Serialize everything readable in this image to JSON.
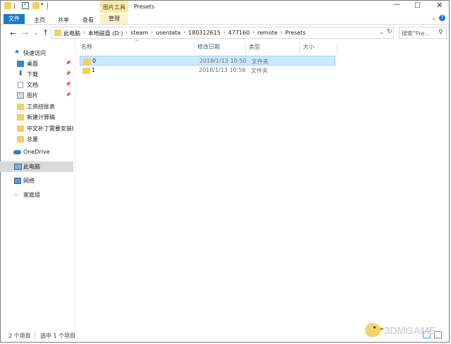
{
  "window": {
    "title": "Presets",
    "context_group_label": "图片工具",
    "controls": {
      "minimize": "—",
      "maximize": "☐",
      "close": "✕"
    }
  },
  "quick_access_toolbar": {
    "dropdown": "▾"
  },
  "ribbon": {
    "tabs": [
      {
        "label": "文件"
      },
      {
        "label": "主页"
      },
      {
        "label": "共享"
      },
      {
        "label": "查看"
      },
      {
        "label": "管理"
      }
    ],
    "expand_glyph": "⌄",
    "help_glyph": "?"
  },
  "address_bar": {
    "back": "←",
    "forward": "→",
    "recent": "⌄",
    "up": "↑",
    "breadcrumbs": [
      "此电脑",
      "本地磁盘 (D:)",
      "steam",
      "userdata",
      "180312615",
      "477160",
      "remote",
      "Presets"
    ],
    "separator": "›",
    "dropdown": "⌄",
    "refresh": "↻"
  },
  "search": {
    "placeholder": "搜索\"Pre...",
    "icon": "search-icon"
  },
  "nav_pane": {
    "quick_access": {
      "label": "快速访问"
    },
    "pinned": [
      {
        "label": "桌面",
        "icon": "desktop-icon"
      },
      {
        "label": "下载",
        "icon": "download-icon"
      },
      {
        "label": "文档",
        "icon": "documents-icon"
      },
      {
        "label": "图片",
        "icon": "pictures-icon"
      }
    ],
    "folders": [
      {
        "label": "工资结账表"
      },
      {
        "label": "新建计算稿"
      },
      {
        "label": "中文补丁需要安装E"
      },
      {
        "label": "总量"
      }
    ],
    "onedrive": {
      "label": "OneDrive"
    },
    "this_pc": {
      "label": "此电脑"
    },
    "network": {
      "label": "网络"
    },
    "homegroup": {
      "label": "家庭组"
    },
    "pin_glyph": "📌"
  },
  "file_list": {
    "sort_glyph": "^",
    "columns": [
      "名称",
      "修改日期",
      "类型",
      "大小"
    ],
    "rows": [
      {
        "name": "0",
        "modified": "2018/1/13 10:50",
        "type": "文件夹",
        "size": ""
      },
      {
        "name": "1",
        "modified": "2018/1/13 10:56",
        "type": "文件夹",
        "size": ""
      }
    ]
  },
  "status_bar": {
    "item_count": "2 个项目",
    "selection": "选中 1 个项目"
  },
  "watermark": {
    "text": "3DMGAME"
  },
  "colors": {
    "accent": "#1979ca",
    "selection_bg": "#cce8ff",
    "selection_border": "#99d1ff",
    "folder": "#f3cf64",
    "context_tab": "#fbe9a3"
  }
}
